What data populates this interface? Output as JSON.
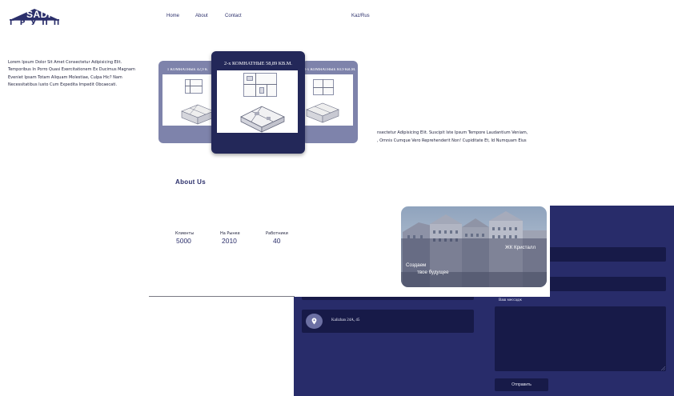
{
  "brand": {
    "logo_text": "SADI",
    "logo_subtitle": "ГРУПП"
  },
  "nav": {
    "items": [
      {
        "label": "Home"
      },
      {
        "label": "About"
      },
      {
        "label": "Contact"
      }
    ],
    "language": "Kaz/Rus"
  },
  "intro": {
    "text": "Lorem Ipsum Dolor Sit Amet Consectetur Adipisicing Elit. Temporibus In Porro Quasi Exercitationem Ex Ducimus Magnam Eveniet Ipsam Totam Aliquam Molestiae, Culpa Hic? Nam Necessitatibus Iusto Cum Expedita Impedit Obcaecati."
  },
  "slider": {
    "slides": [
      {
        "title": "1 КОМНАТНЫЕ 42,9 К"
      },
      {
        "title": "2-х КОМНАТНЫЕ 58,89 КВ.М."
      },
      {
        "title": "3-х КОМНАТНЫЕ 84.9 КВ.М."
      }
    ]
  },
  "feature_text": {
    "line1": "nsectetur Adipisicing Elit. Suscipit Iste Ipsum Tempore Laudantium Veniam,",
    "line2": ", Omnis Cumque Vero Reprehenderit Non! Cupiditate Et, Id Numquam Eius"
  },
  "about": {
    "title": "About Us",
    "stats": [
      {
        "label": "Клиенты",
        "value": "5000"
      },
      {
        "label": "На Рынке",
        "value": "2010"
      },
      {
        "label": "Работники",
        "value": "40"
      }
    ]
  },
  "showcase": {
    "project_name": "ЖК Кристалл",
    "slogan_line1": "Создаем",
    "slogan_line2": "твое будущее"
  },
  "contact": {
    "address": "Kalizhan 24A, 45",
    "message_label": "Ваш мессадж",
    "send_label": "Отправить"
  },
  "colors": {
    "navy": "#282c6a",
    "navy_dark": "#171a48",
    "slide_side": "#7e83ab",
    "slide_active": "#232859"
  }
}
